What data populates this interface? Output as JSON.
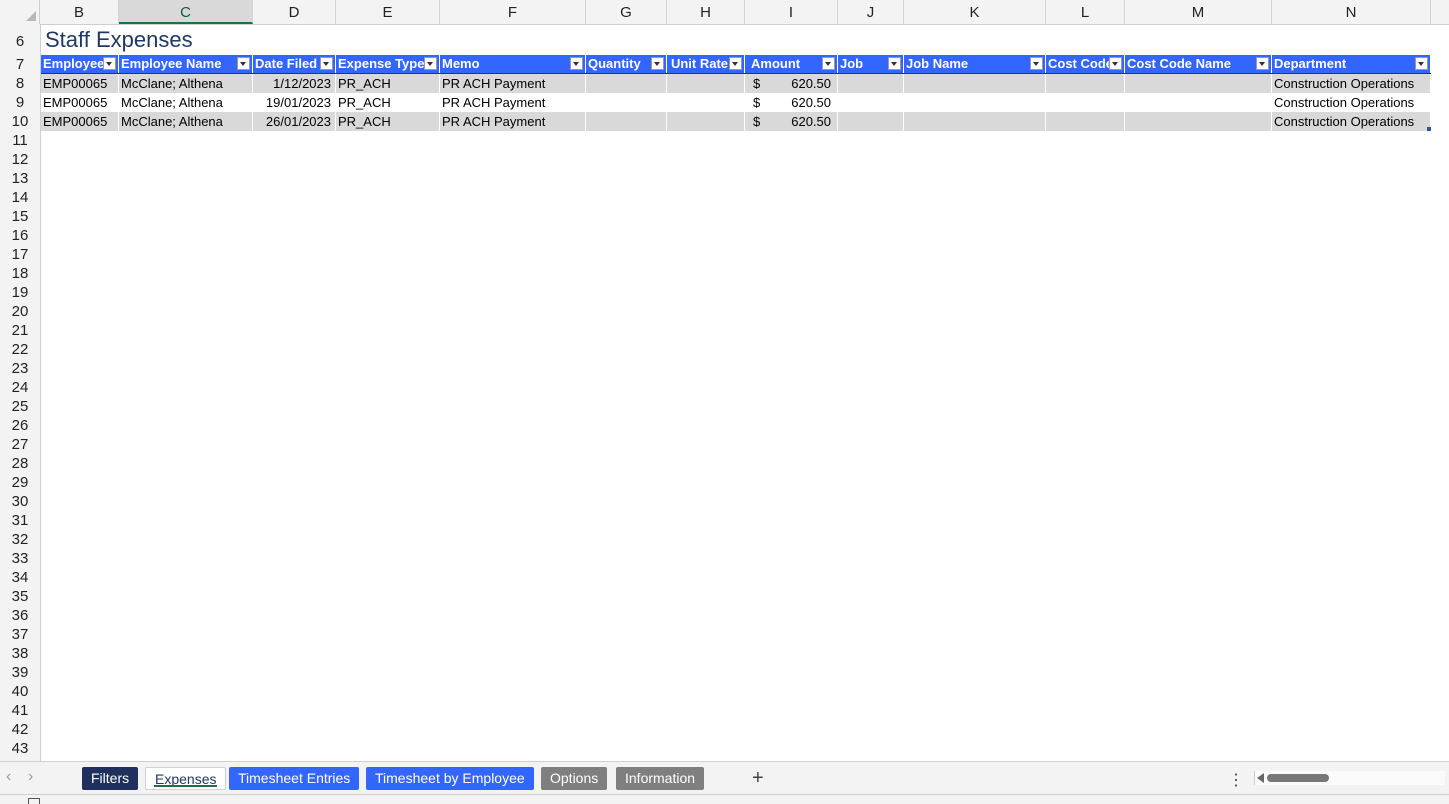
{
  "columns": [
    "B",
    "C",
    "D",
    "E",
    "F",
    "G",
    "H",
    "I",
    "J",
    "K",
    "L",
    "M",
    "N"
  ],
  "rows": [
    "6",
    "7",
    "8",
    "9",
    "10",
    "11",
    "12",
    "13",
    "14",
    "15",
    "16",
    "17",
    "18",
    "19",
    "20",
    "21",
    "22",
    "23",
    "24",
    "25",
    "26",
    "27",
    "28",
    "29",
    "30",
    "31",
    "32",
    "33",
    "34",
    "35",
    "36",
    "37",
    "38",
    "39",
    "40",
    "41",
    "42",
    "43"
  ],
  "sheet": {
    "title": "Staff Expenses",
    "headers": [
      "Employee",
      "Employee Name",
      "Date Filed",
      "Expense Type",
      "Memo",
      "Quantity",
      "Unit Rate",
      "Amount",
      "Job",
      "Job Name",
      "Cost Code",
      "Cost Code Name",
      "Department"
    ],
    "records": [
      {
        "employee": "EMP00065",
        "name": "McClane; Althena",
        "date": "1/12/2023",
        "type": "PR_ACH",
        "memo": "PR ACH Payment",
        "quantity": "",
        "unit_rate": "",
        "currency": "$",
        "amount": "620.50",
        "job": "",
        "job_name": "",
        "cost_code": "",
        "cost_code_name": "",
        "department": "Construction Operations"
      },
      {
        "employee": "EMP00065",
        "name": "McClane; Althena",
        "date": "19/01/2023",
        "type": "PR_ACH",
        "memo": "PR ACH Payment",
        "quantity": "",
        "unit_rate": "",
        "currency": "$",
        "amount": "620.50",
        "job": "",
        "job_name": "",
        "cost_code": "",
        "cost_code_name": "",
        "department": "Construction Operations"
      },
      {
        "employee": "EMP00065",
        "name": "McClane; Althena",
        "date": "26/01/2023",
        "type": "PR_ACH",
        "memo": "PR ACH Payment",
        "quantity": "",
        "unit_rate": "",
        "currency": "$",
        "amount": "620.50",
        "job": "",
        "job_name": "",
        "cost_code": "",
        "cost_code_name": "",
        "department": "Construction Operations"
      }
    ]
  },
  "tabs": [
    {
      "label": "Filters",
      "style": "navy"
    },
    {
      "label": "Expenses",
      "style": "active"
    },
    {
      "label": "Timesheet Entries",
      "style": "blue"
    },
    {
      "label": "Timesheet by Employee",
      "style": "blue"
    },
    {
      "label": "Options",
      "style": "gray"
    },
    {
      "label": "Information",
      "style": "gray"
    }
  ],
  "tabbar": {
    "add_icon": "+",
    "more_icon": "⋮",
    "prev_icon": "‹",
    "next_icon": "›"
  },
  "colors": {
    "header_blue": "#3366ff",
    "navy": "#1f2f5e",
    "title": "#1f3864",
    "stripe": "#d9d9d9",
    "selected_col": "#1e7145"
  }
}
